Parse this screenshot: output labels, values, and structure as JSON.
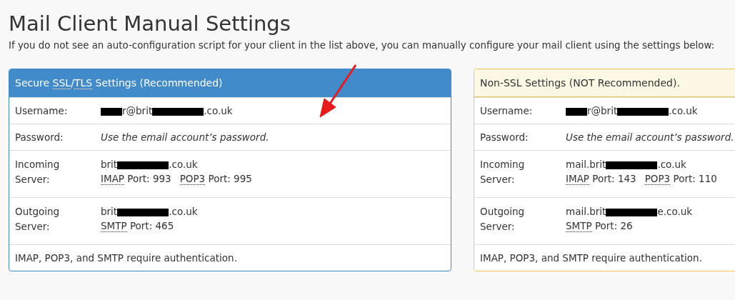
{
  "title": "Mail Client Manual Settings",
  "intro": "If you do not see an auto-configuration script for your client in the list above, you can manually configure your mail client using the settings below:",
  "panels": [
    {
      "kind": "secure",
      "heading": [
        {
          "text": "Secure "
        },
        {
          "text": "SSL",
          "abbr": true
        },
        {
          "text": "/"
        },
        {
          "text": "TLS",
          "abbr": true
        },
        {
          "text": " Settings (Recommended)"
        }
      ],
      "username": {
        "label": "Username:",
        "value": [
          {
            "kind": "mask-short"
          },
          {
            "kind": "text",
            "text": "r@brit"
          },
          {
            "kind": "mask-long"
          },
          {
            "kind": "text",
            "text": ".co.uk"
          }
        ]
      },
      "password": {
        "label": "Password:",
        "value": "Use the email account’s password."
      },
      "incoming": {
        "label": "Incoming Server:",
        "host": [
          {
            "kind": "text",
            "text": "brit"
          },
          {
            "kind": "mask-long"
          },
          {
            "kind": "text",
            "text": ".co.uk"
          }
        ],
        "ports": [
          {
            "protocol": "IMAP",
            "port": "Port: 993"
          },
          {
            "protocol": "POP3",
            "port": "Port: 995"
          }
        ]
      },
      "outgoing": {
        "label": "Outgoing Server:",
        "host": [
          {
            "kind": "text",
            "text": "brit"
          },
          {
            "kind": "mask-long"
          },
          {
            "kind": "text",
            "text": ".co.uk"
          }
        ],
        "ports": [
          {
            "protocol": "SMTP",
            "port": "Port: 465"
          }
        ]
      },
      "footer": "IMAP, POP3, and SMTP require authentication."
    },
    {
      "kind": "plain",
      "heading": [
        {
          "text": "Non-SSL Settings (NOT Recommended)."
        }
      ],
      "username": {
        "label": "Username:",
        "value": [
          {
            "kind": "mask-short"
          },
          {
            "kind": "text",
            "text": "r@brit"
          },
          {
            "kind": "mask-long"
          },
          {
            "kind": "text",
            "text": ".co.uk"
          }
        ]
      },
      "password": {
        "label": "Password:",
        "value": "Use the email account’s password."
      },
      "incoming": {
        "label": "Incoming Server:",
        "host": [
          {
            "kind": "text",
            "text": "mail.brit"
          },
          {
            "kind": "mask-long"
          },
          {
            "kind": "text",
            "text": ".co.uk"
          }
        ],
        "ports": [
          {
            "protocol": "IMAP",
            "port": "Port: 143"
          },
          {
            "protocol": "POP3",
            "port": "Port: 110"
          }
        ]
      },
      "outgoing": {
        "label": "Outgoing Server:",
        "host": [
          {
            "kind": "text",
            "text": "mail.brit"
          },
          {
            "kind": "mask-long"
          },
          {
            "kind": "text",
            "text": "e.co.uk"
          }
        ],
        "ports": [
          {
            "protocol": "SMTP",
            "port": "Port: 26"
          }
        ]
      },
      "footer": "IMAP, POP3, and SMTP require authentication."
    }
  ]
}
